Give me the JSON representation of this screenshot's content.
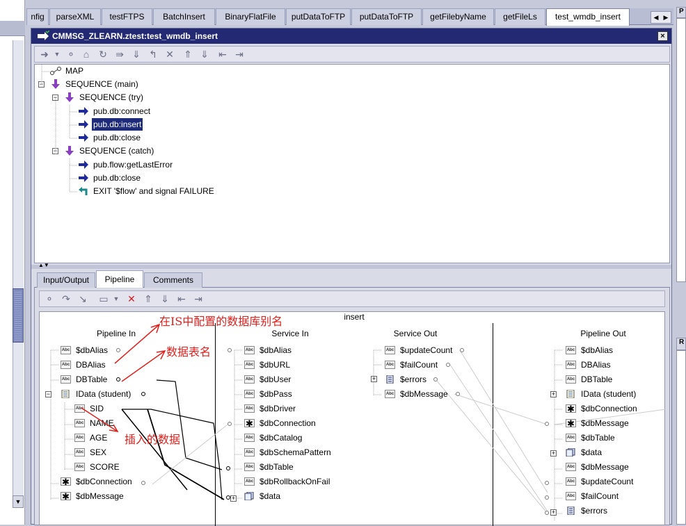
{
  "tabs": [
    "nfig",
    "parseXML",
    "testFTPS",
    "BatchInsert",
    "BinaryFlatFile",
    "putDataToFTP",
    "putDataToFTP",
    "getFilebyName",
    "getFileLs",
    "test_wmdb_insert"
  ],
  "active_tab_index": 9,
  "editor": {
    "title": "CMMSG_ZLEARN.ztest:test_wmdb_insert",
    "close": "×"
  },
  "tree": {
    "nodes": [
      {
        "label": "MAP",
        "icon": "map-icon"
      },
      {
        "label": "SEQUENCE (main)",
        "icon": "sequence-icon"
      },
      {
        "label": "SEQUENCE (try)",
        "icon": "sequence-icon"
      },
      {
        "label": "pub.db:connect",
        "icon": "invoke-icon"
      },
      {
        "label": "pub.db:insert",
        "icon": "invoke-icon",
        "selected": true
      },
      {
        "label": "pub.db:close",
        "icon": "invoke-icon"
      },
      {
        "label": "SEQUENCE (catch)",
        "icon": "sequence-icon"
      },
      {
        "label": "pub.flow:getLastError",
        "icon": "invoke-icon"
      },
      {
        "label": "pub.db:close",
        "icon": "invoke-icon"
      },
      {
        "label": "EXIT '$flow' and signal FAILURE",
        "icon": "exit-icon"
      }
    ]
  },
  "subtabs": [
    "Input/Output",
    "Pipeline",
    "Comments"
  ],
  "active_subtab_index": 1,
  "pipeline": {
    "service_name": "insert",
    "pipeline_in_header": "Pipeline In",
    "service_in_header": "Service In",
    "service_out_header": "Service Out",
    "pipeline_out_header": "Pipeline Out",
    "pipeline_in": [
      "$dbAlias",
      "DBAlias",
      "DBTable",
      "IData (student)",
      "SID",
      "NAME",
      "AGE",
      "SEX",
      "SCORE",
      "$dbConnection",
      "$dbMessage"
    ],
    "service_in": [
      "$dbAlias",
      "$dbURL",
      "$dbUser",
      "$dbPass",
      "$dbDriver",
      "$dbConnection",
      "$dbCatalog",
      "$dbSchemaPattern",
      "$dbTable",
      "$dbRollbackOnFail",
      "$data"
    ],
    "service_out": [
      "$updateCount",
      "$failCount",
      "$errors",
      "$dbMessage"
    ],
    "pipeline_out": [
      "$dbAlias",
      "DBAlias",
      "DBTable",
      "IData (student)",
      "$dbConnection",
      "$dbMessage",
      "$dbTable",
      "$data",
      "$dbMessage",
      "$updateCount",
      "$failCount",
      "$errors"
    ]
  },
  "annotations": {
    "alias": "在IS中配置的数据库别名",
    "table": "数据表名",
    "data": "插入的数据"
  },
  "right_pane": {
    "p_label": "P",
    "r_label": "R"
  },
  "colors": {
    "title_bar": "#232a73",
    "selection": "#1e2a7a",
    "annotation": "#e0201c"
  }
}
